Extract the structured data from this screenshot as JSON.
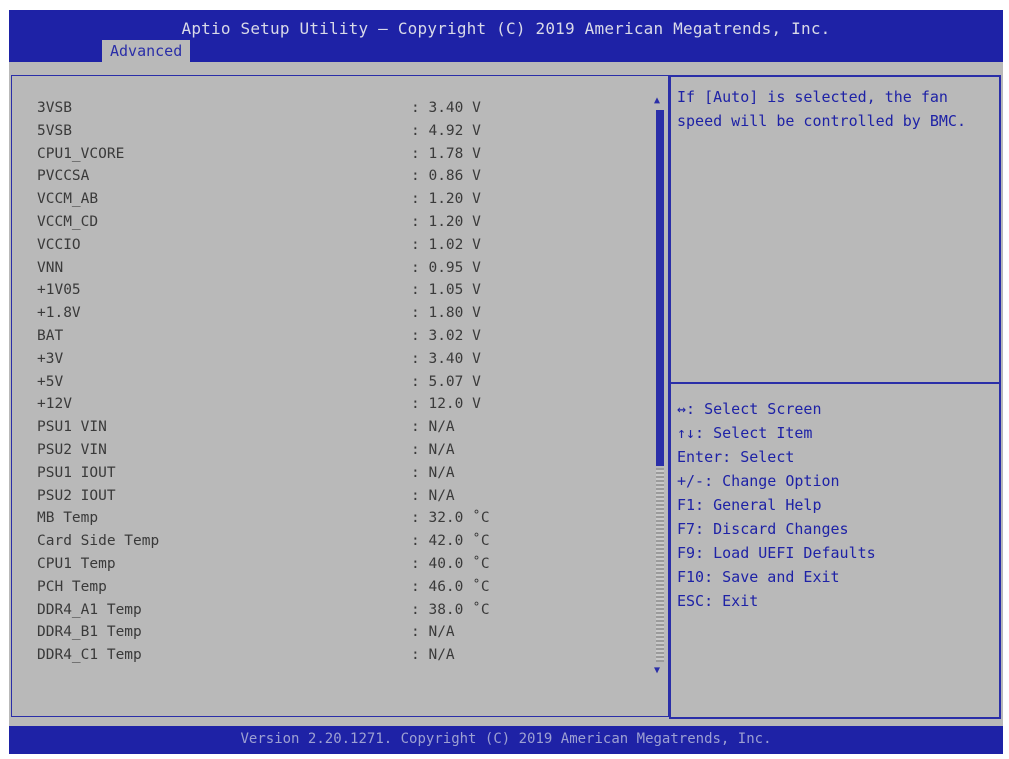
{
  "header": {
    "title": "Aptio Setup Utility – Copyright (C) 2019 American Megatrends, Inc.",
    "tab": "Advanced"
  },
  "rows": [
    {
      "label": "3VSB",
      "value": ": 3.40 V"
    },
    {
      "label": "5VSB",
      "value": ": 4.92 V"
    },
    {
      "label": "CPU1_VCORE",
      "value": ": 1.78 V"
    },
    {
      "label": "PVCCSA",
      "value": ": 0.86 V"
    },
    {
      "label": "VCCM_AB",
      "value": ": 1.20 V"
    },
    {
      "label": "VCCM_CD",
      "value": ": 1.20 V"
    },
    {
      "label": "VCCIO",
      "value": ": 1.02 V"
    },
    {
      "label": "VNN",
      "value": ": 0.95 V"
    },
    {
      "label": "+1V05",
      "value": ": 1.05 V"
    },
    {
      "label": "+1.8V",
      "value": ": 1.80 V"
    },
    {
      "label": "BAT",
      "value": ": 3.02 V"
    },
    {
      "label": "+3V",
      "value": ": 3.40 V"
    },
    {
      "label": "+5V",
      "value": ": 5.07 V"
    },
    {
      "label": "+12V",
      "value": ": 12.0 V"
    },
    {
      "label": "PSU1 VIN",
      "value": ": N/A"
    },
    {
      "label": "PSU2 VIN",
      "value": ": N/A"
    },
    {
      "label": "PSU1 IOUT",
      "value": ": N/A"
    },
    {
      "label": "PSU2 IOUT",
      "value": ": N/A"
    },
    {
      "label": "MB Temp",
      "value": ": 32.0 ˚C"
    },
    {
      "label": "Card Side Temp",
      "value": ": 42.0 ˚C"
    },
    {
      "label": "CPU1 Temp",
      "value": ": 40.0 ˚C"
    },
    {
      "label": "PCH Temp",
      "value": ": 46.0 ˚C"
    },
    {
      "label": "DDR4_A1 Temp",
      "value": ": 38.0 ˚C"
    },
    {
      "label": "DDR4_B1 Temp",
      "value": ": N/A"
    },
    {
      "label": "DDR4_C1 Temp",
      "value": ": N/A"
    }
  ],
  "help_text": "If [Auto] is selected, the fan speed will be controlled by BMC.",
  "keys": [
    "↔: Select Screen",
    "↑↓: Select Item",
    "Enter: Select",
    "+/-: Change Option",
    "F1: General Help",
    "F7: Discard Changes",
    "F9: Load UEFI Defaults",
    "F10: Save and Exit",
    "ESC: Exit"
  ],
  "scrollbar": {
    "up_arrow": "▲",
    "down_arrow": "▼"
  },
  "footer": {
    "text": "Version 2.20.1271. Copyright (C) 2019 American Megatrends, Inc."
  },
  "colors": {
    "header_bg": "#1e22a6",
    "panel_bg": "#b9b9b9",
    "accent": "#2a2ea8"
  }
}
